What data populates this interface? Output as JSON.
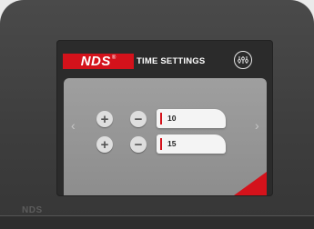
{
  "device": {
    "bezel_logo": "NDS"
  },
  "header": {
    "logo": "NDS",
    "title": "TIME SETTINGS",
    "settings_icon": "dial-settings-icon"
  },
  "nav": {
    "prev": "‹",
    "next": "›"
  },
  "rows": [
    {
      "value": "10"
    },
    {
      "value": "15"
    }
  ],
  "colors": {
    "accent": "#d4121b",
    "panel": "#9a9a9a",
    "screen": "#2b2b2b"
  }
}
